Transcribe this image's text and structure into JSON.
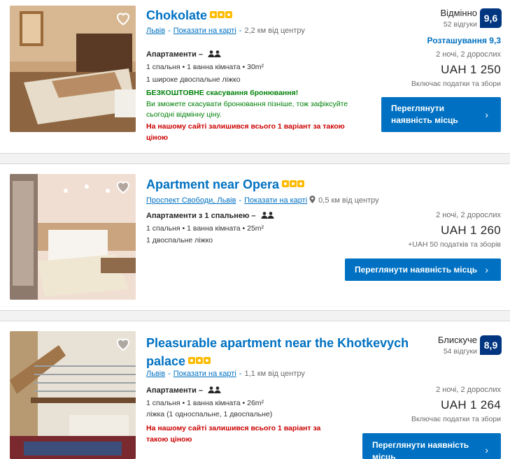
{
  "listings": [
    {
      "title": "Chokolate",
      "city": "Львів",
      "map_link": "Показати на карті",
      "distance": "2,2 км від центру",
      "unit_type": "Апартаменти –",
      "beds_line": "1 спальня • 1 ванна кімната • 30m²",
      "bed_type": "1 широке двоспальне ліжко",
      "free_cancel": "БЕЗКОШТОВНЕ скасування бронювання!",
      "cancel_note_1": "Ви зможете скасувати бронювання пізніше, тож зафіксуйте",
      "cancel_note_2": "сьогодні відмінну ціну.",
      "scarcity_1": "На нашому сайті залишився всього 1 варіант за такою",
      "scarcity_2": "ціною",
      "review_word": "Відмінно",
      "review_count": "52 відгуки",
      "score": "9,6",
      "location_score": "Розташування 9,3",
      "stay": "2 ночі, 2 дорослих",
      "price": "UAH 1 250",
      "taxes": "Включає податки та збори",
      "button_1": "Переглянути",
      "button_2": "наявність місць",
      "button_chevron": "›"
    },
    {
      "title": "Apartment near Opera",
      "address": "Проспект Свободи, Львів",
      "map_link": "Показати на карті",
      "distance": "0,5 км від центру",
      "unit_type": "Апартаменти з 1 спальнею –",
      "beds_line": "1 спальня • 1 ванна кімната • 25m²",
      "bed_type": "1 двоспальне ліжко",
      "stay": "2 ночі, 2 дорослих",
      "price": "UAH 1 260",
      "taxes": "+UAH 50 податків та зборів",
      "button": "Переглянути наявність місць",
      "button_chevron": "›"
    },
    {
      "title_1": "Pleasurable apartment near the Khotkevych",
      "title_2": "palace",
      "city": "Львів",
      "map_link": "Показати на карті",
      "distance": "1,1 км від центру",
      "unit_type": "Апартаменти –",
      "beds_line": "1 спальня • 1 ванна кімната • 26m²",
      "bed_type": "ліжка (1 односпальне, 1 двоспальне)",
      "scarcity_1": "На нашому сайті залишився всього 1 варіант за",
      "scarcity_2": "такою ціною",
      "review_word": "Блискуче",
      "review_count": "54 відгуки",
      "score": "8,9",
      "stay": "2 ночі, 2 дорослих",
      "price": "UAH 1 264",
      "taxes": "Включає податки та збори",
      "button_1": "Переглянути наявність",
      "button_2": "місць",
      "button_chevron": "›"
    }
  ]
}
